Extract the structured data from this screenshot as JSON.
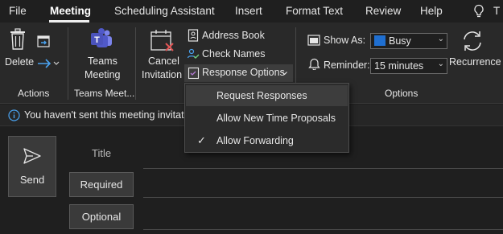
{
  "menu": {
    "tabs": [
      "File",
      "Meeting",
      "Scheduling Assistant",
      "Insert",
      "Format Text",
      "Review",
      "Help"
    ],
    "active": "Meeting",
    "overflow_letter": "T"
  },
  "ribbon": {
    "actions": {
      "delete_label": "Delete",
      "group_label": "Actions"
    },
    "teams": {
      "button_line1": "Teams",
      "button_line2": "Meeting",
      "group_label": "Teams Meet..."
    },
    "attendees": {
      "cancel_line1": "Cancel",
      "cancel_line2": "Invitation",
      "address_book": "Address Book",
      "check_names": "Check Names",
      "response_options": "Response Options"
    },
    "options": {
      "show_as_label": "Show As:",
      "show_as_value": "Busy",
      "show_as_color": "#1f6fd1",
      "reminder_label": "Reminder:",
      "reminder_value": "15 minutes",
      "recurrence_label": "Recurrence",
      "group_label": "Options"
    }
  },
  "info_bar": {
    "text": "You haven't sent this meeting invitation"
  },
  "compose": {
    "send_label": "Send",
    "title_placeholder": "Title",
    "required_label": "Required",
    "optional_label": "Optional"
  },
  "response_menu": {
    "items": [
      {
        "label": "Request Responses",
        "checked": false,
        "hovered": true
      },
      {
        "label": "Allow New Time Proposals",
        "checked": false,
        "hovered": false
      },
      {
        "label": "Allow Forwarding",
        "checked": true,
        "hovered": false
      }
    ],
    "check_glyph": "✓"
  }
}
